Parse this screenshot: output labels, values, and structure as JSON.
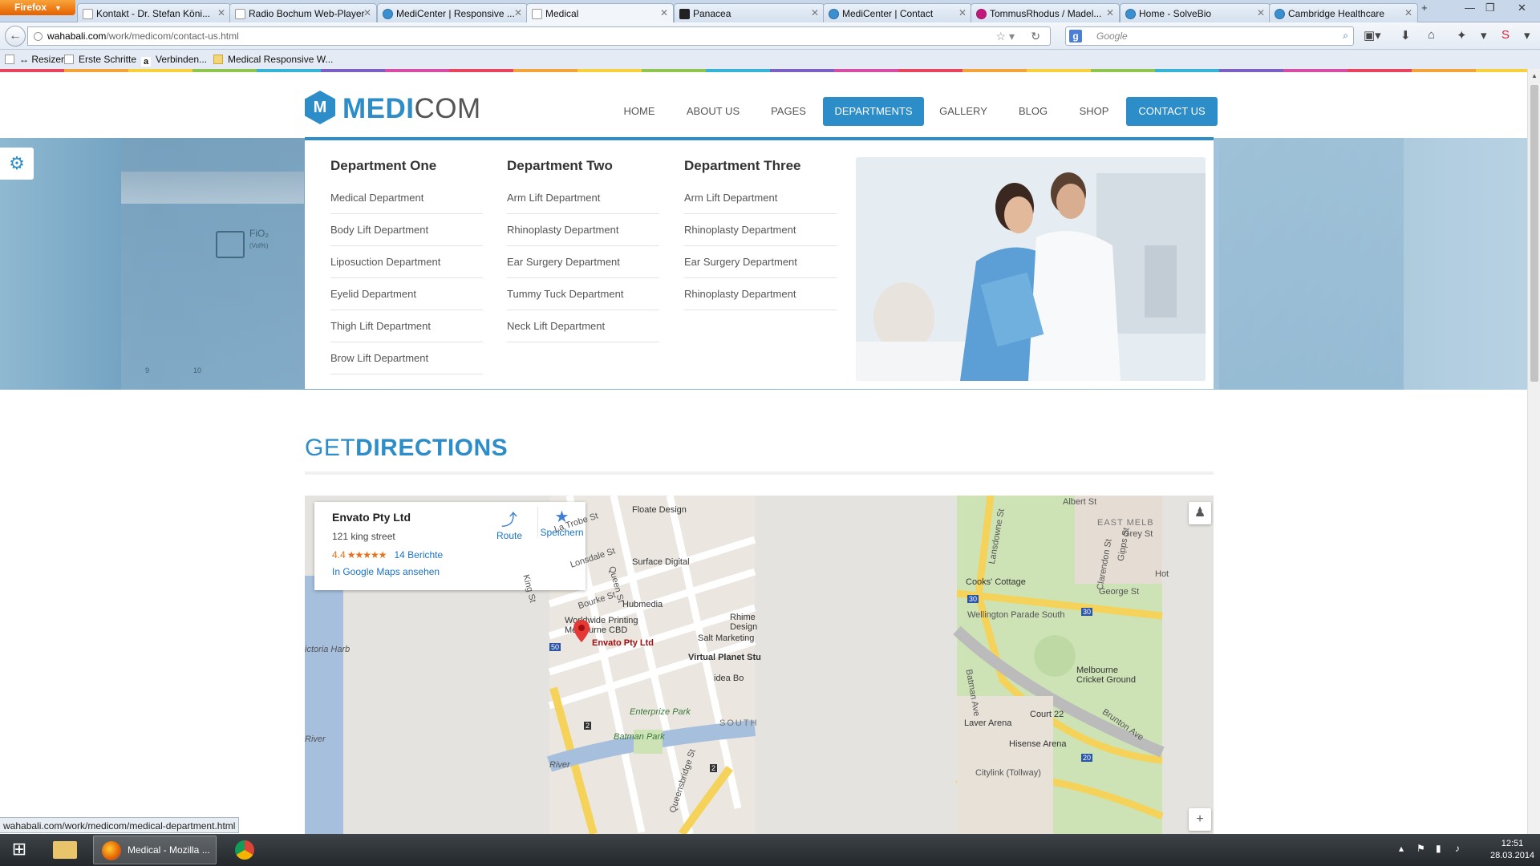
{
  "browser": {
    "menu_button": "Firefox",
    "tabs": [
      {
        "title": "Kontakt - Dr. Stefan Köni..."
      },
      {
        "title": "Radio Bochum Web-Player"
      },
      {
        "title": "MediCenter | Responsive ..."
      },
      {
        "title": "Medical"
      },
      {
        "title": "Panacea"
      },
      {
        "title": "MediCenter | Contact"
      },
      {
        "title": "TommusRhodus / Madel..."
      },
      {
        "title": "Home - SolveBio"
      },
      {
        "title": "Cambridge Healthcare"
      }
    ],
    "active_tab_index": 3,
    "url_host": "wahabali.com",
    "url_path": "/work/medicom/contact-us.html",
    "search_placeholder": "Google",
    "bookmarks": [
      {
        "label": "↔ Resizer"
      },
      {
        "label": "Erste Schritte"
      },
      {
        "label": "Verbinden..."
      },
      {
        "label": "Medical Responsive W..."
      }
    ],
    "status_url": "wahabali.com/work/medicom/medical-department.html"
  },
  "site": {
    "logo_letter": "M",
    "logo_bold": "MEDI",
    "logo_light": "COM",
    "nav": [
      {
        "label": "HOME"
      },
      {
        "label": "ABOUT US"
      },
      {
        "label": "PAGES"
      },
      {
        "label": "DEPARTMENTS"
      },
      {
        "label": "GALLERY"
      },
      {
        "label": "BLOG"
      },
      {
        "label": "SHOP"
      },
      {
        "label": "CONTACT US"
      }
    ],
    "accent_color": "#2d8dc8",
    "mega_menu": {
      "columns": [
        {
          "title": "Department One",
          "items": [
            "Medical Department",
            "Body Lift Department",
            "Liposuction Department",
            "Eyelid Department",
            "Thigh Lift Department",
            "Brow Lift Department"
          ]
        },
        {
          "title": "Department Two",
          "items": [
            "Arm Lift Department",
            "Rhinoplasty Department",
            "Ear Surgery Department",
            "Tummy Tuck Department",
            "Neck Lift Department"
          ]
        },
        {
          "title": "Department Three",
          "items": [
            "Arm Lift Department",
            "Rhinoplasty Department",
            "Ear Surgery Department",
            "Rhinoplasty Department"
          ]
        }
      ]
    },
    "hero_text": {
      "fio": "FiO₂",
      "unit": "(Vol%)",
      "n1": "9",
      "n2": "10"
    },
    "directions_light": "GET",
    "directions_bold": "DIRECTIONS"
  },
  "map": {
    "place_name": "Envato Pty Ltd",
    "address": "121 king street",
    "rating": "4.4",
    "stars": "★★★★★",
    "reviews": "14 Berichte",
    "view_link": "In Google Maps ansehen",
    "route_label": "Route",
    "save_label": "Speichern",
    "labels": {
      "floate": "Floate Design",
      "latrobe": "La Trobe St",
      "lonsdale": "Lonsdale St",
      "surface": "Surface Digital",
      "queen": "Queen St",
      "bourke": "Bourke St",
      "king": "King St",
      "hubmedia": "Hubmedia",
      "worldwide": "Worldwide Printing",
      "melbcbd": "Melbourne CBD",
      "rhime": "Rhime",
      "rhime2": "Design",
      "salt": "Salt Marketing",
      "virtual": "Virtual Planet Stu",
      "idea": "idea Bo",
      "enterprize": "Enterprize Park",
      "batman": "Batman Park",
      "queensbridge": "Queensbridge St",
      "south": "SOUTH",
      "victoria": "ictoria Harb",
      "river": "River",
      "river2": "River",
      "albert": "Albert St",
      "eastmelb": "EAST MELB",
      "grey": "Grey St",
      "lansdowne": "Lansdowne St",
      "clarendon": "Clarendon St",
      "gipps": "Gipps St",
      "george": "George St",
      "cooks": "Cooks' Cottage",
      "wellington": "Wellington Parade South",
      "mcg": "Melbourne",
      "mcg2": "Cricket Ground",
      "batmanave": "Batman Ave",
      "court22": "Court 22",
      "laver": "Laver Arena",
      "brunton": "Brunton Ave",
      "hisense": "Hisense Arena",
      "citylink": "Citylink (Tollway)",
      "hot": "Hot",
      "r30a": "30",
      "r30b": "30",
      "r20": "20",
      "r2": "2",
      "r2b": "2",
      "r50": "50"
    },
    "zoom_in": "+"
  },
  "taskbar": {
    "active_app": "Medical - Mozilla ...",
    "time": "12:51",
    "date": "28.03.2014"
  }
}
